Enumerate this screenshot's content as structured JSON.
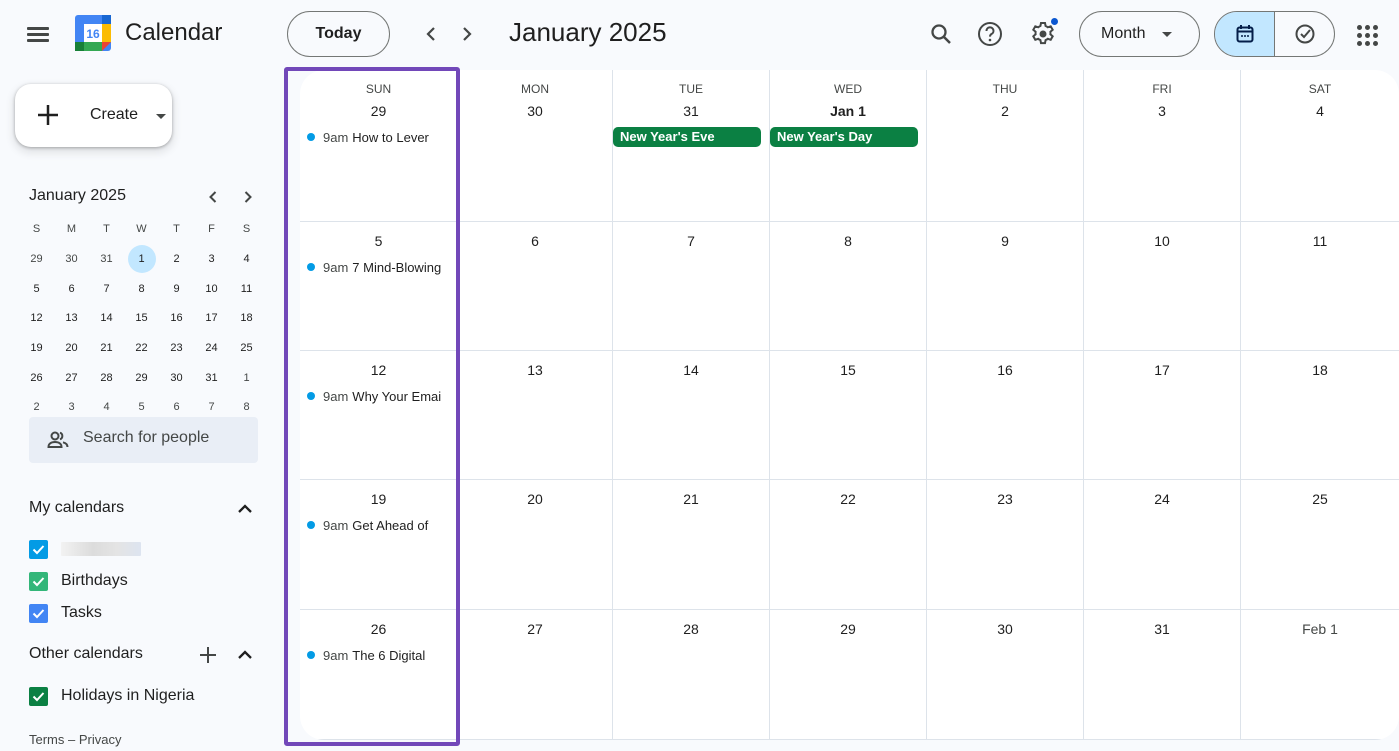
{
  "header": {
    "menu_icon": "hamburger-menu-icon",
    "logo_day": "16",
    "app_title": "Calendar",
    "today_label": "Today",
    "period_title": "January 2025",
    "view_select": "Month",
    "icons": [
      "search-icon",
      "help-icon",
      "settings-icon",
      "calendar-view-icon",
      "tasks-check-icon",
      "apps-grid-icon"
    ]
  },
  "sidebar": {
    "create_label": "Create",
    "mini_calendar": {
      "title": "January 2025",
      "weekday_headers": [
        "S",
        "M",
        "T",
        "W",
        "T",
        "F",
        "S"
      ],
      "days": [
        {
          "d": "29",
          "other": true
        },
        {
          "d": "30",
          "other": true
        },
        {
          "d": "31",
          "other": true
        },
        {
          "d": "1",
          "today": true
        },
        {
          "d": "2"
        },
        {
          "d": "3"
        },
        {
          "d": "4"
        },
        {
          "d": "5"
        },
        {
          "d": "6"
        },
        {
          "d": "7"
        },
        {
          "d": "8"
        },
        {
          "d": "9"
        },
        {
          "d": "10"
        },
        {
          "d": "11"
        },
        {
          "d": "12"
        },
        {
          "d": "13"
        },
        {
          "d": "14"
        },
        {
          "d": "15"
        },
        {
          "d": "16"
        },
        {
          "d": "17"
        },
        {
          "d": "18"
        },
        {
          "d": "19"
        },
        {
          "d": "20"
        },
        {
          "d": "21"
        },
        {
          "d": "22"
        },
        {
          "d": "23"
        },
        {
          "d": "24"
        },
        {
          "d": "25"
        },
        {
          "d": "26"
        },
        {
          "d": "27"
        },
        {
          "d": "28"
        },
        {
          "d": "29"
        },
        {
          "d": "30"
        },
        {
          "d": "31"
        },
        {
          "d": "1",
          "other": true
        },
        {
          "d": "2",
          "other": true
        },
        {
          "d": "3",
          "other": true
        },
        {
          "d": "4",
          "other": true
        },
        {
          "d": "5",
          "other": true
        },
        {
          "d": "6",
          "other": true
        },
        {
          "d": "7",
          "other": true
        },
        {
          "d": "8",
          "other": true
        }
      ]
    },
    "search_people_placeholder": "Search for people",
    "my_calendars": {
      "title": "My calendars",
      "items": [
        {
          "name": "",
          "redacted": true,
          "color": "#039be5",
          "checked": true
        },
        {
          "name": "Birthdays",
          "color": "#33b679",
          "checked": true
        },
        {
          "name": "Tasks",
          "color": "#4285f4",
          "checked": true
        }
      ]
    },
    "other_calendars": {
      "title": "Other calendars",
      "items": [
        {
          "name": "Holidays in Nigeria",
          "color": "#0b8043",
          "checked": true
        }
      ]
    },
    "footer": {
      "terms": "Terms",
      "separator": "–",
      "privacy": "Privacy"
    }
  },
  "month_grid": {
    "weekdays": [
      "SUN",
      "MON",
      "TUE",
      "WED",
      "THU",
      "FRI",
      "SAT"
    ],
    "weeks": [
      [
        {
          "date": "29",
          "other": true,
          "events": [
            {
              "type": "timed",
              "time": "9am",
              "title": "How to Lever"
            }
          ]
        },
        {
          "date": "30",
          "other": true
        },
        {
          "date": "31",
          "other": true,
          "events": [
            {
              "type": "allday",
              "title": "New Year's Eve"
            }
          ]
        },
        {
          "date": "Jan 1",
          "bold": true,
          "events": [
            {
              "type": "allday",
              "title": "New Year's Day"
            }
          ]
        },
        {
          "date": "2"
        },
        {
          "date": "3"
        },
        {
          "date": "4"
        }
      ],
      [
        {
          "date": "5",
          "events": [
            {
              "type": "timed",
              "time": "9am",
              "title": "7 Mind-Blowing"
            }
          ]
        },
        {
          "date": "6"
        },
        {
          "date": "7"
        },
        {
          "date": "8"
        },
        {
          "date": "9"
        },
        {
          "date": "10"
        },
        {
          "date": "11"
        }
      ],
      [
        {
          "date": "12",
          "events": [
            {
              "type": "timed",
              "time": "9am",
              "title": "Why Your Email"
            }
          ]
        },
        {
          "date": "13"
        },
        {
          "date": "14"
        },
        {
          "date": "15"
        },
        {
          "date": "16"
        },
        {
          "date": "17"
        },
        {
          "date": "18"
        }
      ],
      [
        {
          "date": "19",
          "events": [
            {
              "type": "timed",
              "time": "9am",
              "title": "Get Ahead of"
            }
          ]
        },
        {
          "date": "20"
        },
        {
          "date": "21"
        },
        {
          "date": "22"
        },
        {
          "date": "23"
        },
        {
          "date": "24"
        },
        {
          "date": "25"
        }
      ],
      [
        {
          "date": "26",
          "events": [
            {
              "type": "timed",
              "time": "9am",
              "title": "The 6 Digital"
            }
          ]
        },
        {
          "date": "27"
        },
        {
          "date": "28"
        },
        {
          "date": "29"
        },
        {
          "date": "30"
        },
        {
          "date": "31"
        },
        {
          "date": "Feb 1",
          "other": true
        }
      ]
    ],
    "highlighted_column": "SUN",
    "colors": {
      "highlight": "#7248b9",
      "holiday_chip": "#0b8043",
      "event_dot": "#039be5",
      "today_bg": "#c2e7ff"
    }
  }
}
